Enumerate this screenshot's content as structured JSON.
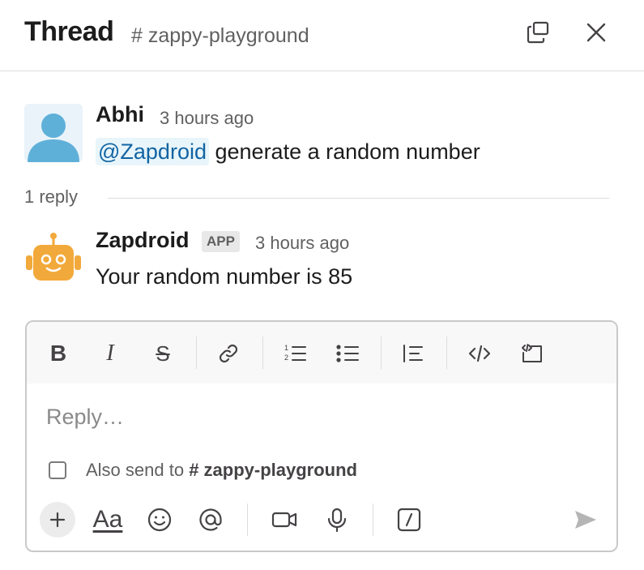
{
  "header": {
    "title": "Thread",
    "channel": "# zappy-playground",
    "icons": {
      "popout": "popout-window-icon",
      "close": "close-icon"
    }
  },
  "messages": [
    {
      "author": "Abhi",
      "time": "3 hours ago",
      "mention": "@Zapdroid",
      "text": "generate a random number",
      "avatar": "default-user-avatar"
    },
    {
      "author": "Zapdroid",
      "badge": "APP",
      "time": "3 hours ago",
      "text": "Your random number is 85",
      "avatar": "robot-avatar"
    }
  ],
  "thread": {
    "reply_count": "1 reply"
  },
  "composer": {
    "placeholder": "Reply…",
    "also_send_prefix": "Also send to",
    "also_send_channel": "# zappy-playground",
    "aa_label": "Aa",
    "toolbar_icons": [
      "bold-icon",
      "italic-icon",
      "strikethrough-icon",
      "link-icon",
      "ordered-list-icon",
      "bulleted-list-icon",
      "blockquote-icon",
      "code-icon",
      "code-block-icon"
    ],
    "bottom_icons": [
      "plus-icon",
      "formatting-icon",
      "emoji-icon",
      "mention-icon",
      "video-icon",
      "microphone-icon",
      "slash-command-icon",
      "send-icon"
    ]
  },
  "colors": {
    "accent_link": "#1264a3",
    "avatar_user": "#5fb0d9",
    "avatar_bot": "#f2a93b",
    "text_secondary": "#616061"
  }
}
